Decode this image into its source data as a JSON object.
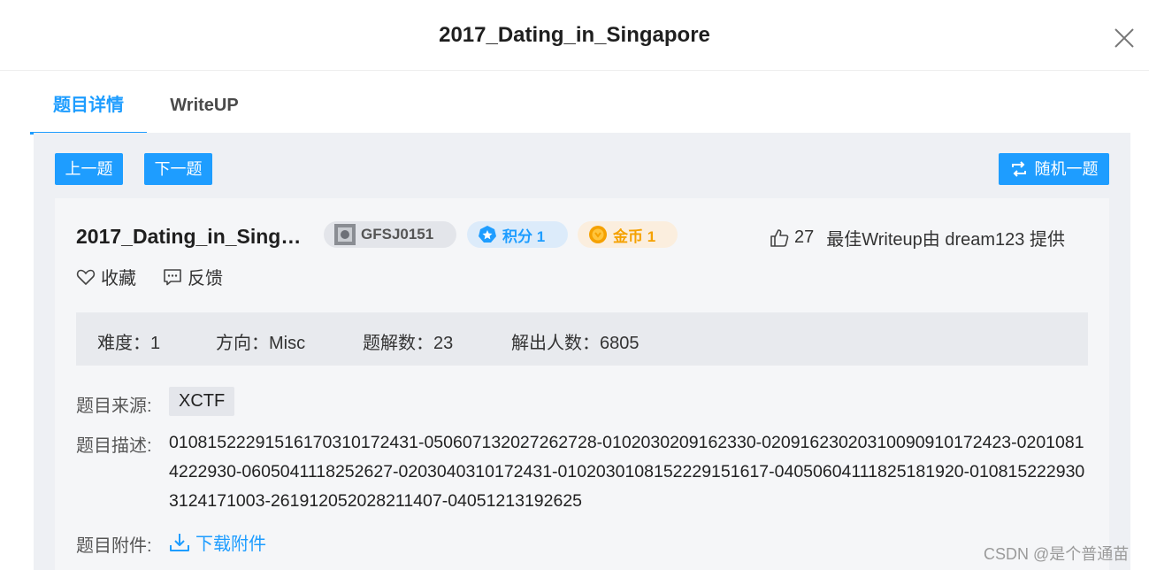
{
  "modal": {
    "title": "2017_Dating_in_Singapore"
  },
  "tabs": [
    {
      "label": "题目详情",
      "active": true
    },
    {
      "label": "WriteUP",
      "active": false
    }
  ],
  "nav": {
    "prev_label": "上一题",
    "next_label": "下一题",
    "random_label": "随机一题"
  },
  "challenge": {
    "title": "2017_Dating_in_Sing…",
    "code": "GFSJ0151",
    "score": "积分 1",
    "coins": "金币 1",
    "likes": "27",
    "best_writeup": "最佳Writeup由 dream123 提供",
    "favorite_label": "收藏",
    "feedback_label": "反馈"
  },
  "stats": {
    "difficulty": "难度：1",
    "direction": "方向：Misc",
    "solves": "题解数：23",
    "solvers": "解出人数：6805"
  },
  "details": {
    "source_label": "题目来源:",
    "source_value": "XCTF",
    "desc_label": "题目描述:",
    "desc_value": "01081522291516170310172431-050607132027262728-0102030209162330-02091623020310090910172423-02010814222930-0605041118252627-0203040310172431-0102030108152229151617-04050604111825181920-0108152229303124171003-261912052028211407-04051213192625",
    "attachment_label": "题目附件:",
    "download_label": "下载附件"
  },
  "watermark": "CSDN @是个普通苗",
  "colors": {
    "accent": "#1e9dff",
    "coin": "#f5a100",
    "panel_bg": "#eef0f4",
    "card_bg": "#f5f6f8"
  },
  "icons": {
    "close": "close-icon",
    "random": "shuffle-icon",
    "code": "avatar-icon",
    "score": "star-badge-icon",
    "coin": "coin-icon",
    "likes": "thumbs-up-icon",
    "favorite": "heart-icon",
    "feedback": "chat-bubble-icon",
    "download": "download-icon"
  }
}
